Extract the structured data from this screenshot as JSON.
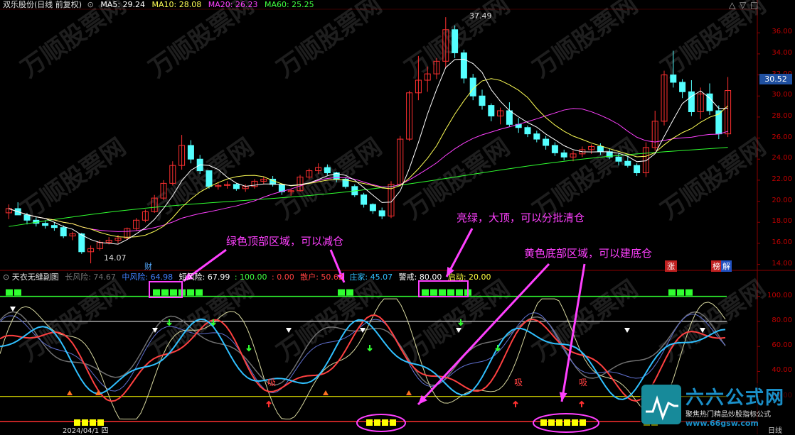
{
  "app": {
    "stock_name": "双乐股份(日线 前复权)",
    "window_icons": [
      "△",
      "▽",
      "□"
    ]
  },
  "ma_legend": [
    {
      "label": "MA5: 29.24",
      "color": "#ffffff"
    },
    {
      "label": "MA10: 28.08",
      "color": "#ffff55"
    },
    {
      "label": "MA20: 26.23",
      "color": "#ff40ff"
    },
    {
      "label": "MA60: 25.25",
      "color": "#40ff40"
    }
  ],
  "price_axis": {
    "ticks": [
      "36.00",
      "34.00",
      "32.00",
      "30.00",
      "28.00",
      "26.00",
      "24.00",
      "22.00",
      "20.00",
      "18.00",
      "16.00",
      "14.00"
    ],
    "current_price": "30.52",
    "high_mark": "37.49",
    "low_mark": "14.07"
  },
  "price_tags": {
    "cai": "财",
    "zhang": "涨",
    "bang": "榜",
    "jie": "解"
  },
  "sub_panel": {
    "title": "天衣无缝副图",
    "indicators": [
      {
        "label": "长风险: 74.67",
        "color": "#707070"
      },
      {
        "label": "中风险: 64.98",
        "color": "#4080ff"
      },
      {
        "label": "短风险: 67.99",
        "color": "#ffffff"
      },
      {
        "label": ": 100.00",
        "color": "#40ff40"
      },
      {
        "label": ": 0.00",
        "color": "#ff4040"
      },
      {
        "label": "散户: 50.62",
        "color": "#ff4040"
      },
      {
        "label": "庄家: 45.07",
        "color": "#30c0ff"
      },
      {
        "label": "警戒: 80.00",
        "color": "#ffffff"
      },
      {
        "label": "启动: 20.00",
        "color": "#ffff40"
      }
    ],
    "ticks": [
      "100.00",
      "80.00",
      "60.00",
      "40.00",
      "20.00"
    ],
    "xi_label": "吸",
    "date_fragment": "2024/04/1 四"
  },
  "annotations": {
    "green_top": "绿色顶部区域，可以减仓",
    "bright_green": "亮绿，大顶，可以分批清仓",
    "yellow_bottom": "黄色底部区域，可以建底仓"
  },
  "brand": {
    "name": "六六公式网",
    "slogan": "聚焦热门精品炒股指标公式",
    "url": "www.66gsw.com",
    "footer_right": "日线"
  },
  "watermark_text": "万顺股票网",
  "colors": {
    "up": "#ff3030",
    "down": "#54ffff",
    "magenta": "#ff40ff",
    "green": "#30ff30",
    "yellow": "#ffff00"
  },
  "chart_data": {
    "type": "candlestick",
    "ylim": [
      13.5,
      37.5
    ],
    "candles": [
      [
        18.9,
        19.7,
        18.3,
        19.3
      ],
      [
        19.3,
        19.9,
        18.7,
        18.7
      ],
      [
        18.7,
        18.9,
        17.8,
        18.2
      ],
      [
        18.2,
        18.5,
        17.6,
        17.9
      ],
      [
        17.9,
        18.2,
        17.4,
        17.7
      ],
      [
        17.7,
        18.0,
        17.2,
        17.5
      ],
      [
        17.5,
        17.7,
        16.5,
        16.7
      ],
      [
        16.7,
        17.1,
        16.3,
        16.9
      ],
      [
        16.9,
        17.0,
        15.0,
        15.2
      ],
      [
        15.2,
        15.8,
        14.1,
        15.5
      ],
      [
        15.5,
        16.3,
        15.3,
        16.1
      ],
      [
        16.1,
        16.6,
        15.9,
        16.3
      ],
      [
        16.3,
        16.8,
        16.0,
        16.5
      ],
      [
        16.5,
        17.5,
        16.4,
        17.4
      ],
      [
        17.4,
        18.4,
        17.2,
        18.2
      ],
      [
        18.2,
        19.2,
        18.0,
        19.0
      ],
      [
        19.0,
        20.6,
        18.9,
        20.3
      ],
      [
        20.3,
        22.0,
        20.1,
        21.7
      ],
      [
        21.7,
        23.8,
        21.5,
        23.4
      ],
      [
        23.4,
        26.3,
        23.0,
        25.3
      ],
      [
        25.3,
        25.8,
        23.6,
        24.0
      ],
      [
        24.0,
        24.4,
        22.6,
        22.9
      ],
      [
        22.9,
        22.7,
        21.2,
        21.4
      ],
      [
        21.4,
        21.8,
        21.1,
        21.5
      ],
      [
        21.5,
        21.9,
        21.2,
        21.6
      ],
      [
        21.6,
        21.7,
        21.0,
        21.2
      ],
      [
        21.2,
        21.6,
        20.9,
        21.4
      ],
      [
        21.4,
        22.1,
        21.2,
        21.9
      ],
      [
        21.9,
        22.3,
        21.6,
        22.1
      ],
      [
        22.1,
        22.4,
        21.4,
        21.6
      ],
      [
        21.6,
        21.7,
        20.6,
        20.9
      ],
      [
        20.9,
        21.2,
        20.5,
        21.0
      ],
      [
        21.0,
        22.5,
        20.9,
        22.3
      ],
      [
        22.3,
        23.1,
        22.1,
        22.9
      ],
      [
        22.9,
        23.6,
        22.6,
        23.2
      ],
      [
        23.2,
        23.5,
        22.5,
        22.7
      ],
      [
        22.7,
        22.8,
        21.8,
        22.1
      ],
      [
        22.1,
        22.2,
        21.2,
        21.4
      ],
      [
        21.4,
        21.6,
        20.4,
        20.6
      ],
      [
        20.6,
        20.8,
        19.4,
        19.7
      ],
      [
        19.7,
        19.8,
        18.8,
        19.1
      ],
      [
        19.1,
        19.4,
        18.3,
        18.6
      ],
      [
        18.6,
        21.9,
        18.4,
        21.6
      ],
      [
        21.6,
        26.2,
        21.4,
        25.9
      ],
      [
        25.9,
        30.5,
        25.7,
        30.3
      ],
      [
        30.3,
        33.8,
        29.6,
        31.5
      ],
      [
        31.5,
        32.8,
        30.4,
        32.1
      ],
      [
        32.1,
        33.6,
        31.6,
        33.3
      ],
      [
        33.3,
        37.49,
        32.7,
        36.3
      ],
      [
        36.3,
        36.7,
        33.6,
        34.1
      ],
      [
        34.1,
        34.4,
        31.2,
        31.7
      ],
      [
        31.7,
        32.1,
        29.6,
        30.0
      ],
      [
        30.0,
        30.6,
        28.7,
        29.1
      ],
      [
        29.1,
        29.3,
        27.6,
        28.1
      ],
      [
        28.1,
        28.9,
        27.3,
        28.6
      ],
      [
        28.6,
        29.4,
        27.1,
        27.3
      ],
      [
        27.3,
        27.9,
        26.5,
        27.0
      ],
      [
        27.0,
        27.2,
        26.1,
        26.4
      ],
      [
        26.4,
        26.7,
        25.6,
        25.9
      ],
      [
        25.9,
        26.2,
        24.9,
        25.3
      ],
      [
        25.3,
        25.6,
        24.3,
        24.6
      ],
      [
        24.6,
        24.9,
        23.9,
        24.2
      ],
      [
        24.2,
        24.8,
        23.8,
        24.5
      ],
      [
        24.5,
        25.2,
        24.2,
        24.9
      ],
      [
        24.9,
        25.4,
        24.5,
        25.2
      ],
      [
        25.2,
        25.5,
        24.4,
        24.7
      ],
      [
        24.7,
        25.0,
        24.0,
        24.2
      ],
      [
        24.2,
        24.6,
        23.4,
        23.8
      ],
      [
        23.8,
        24.2,
        23.2,
        23.4
      ],
      [
        23.4,
        23.6,
        22.4,
        22.7
      ],
      [
        22.7,
        25.6,
        22.3,
        25.1
      ],
      [
        25.1,
        28.6,
        24.8,
        27.6
      ],
      [
        27.6,
        32.4,
        27.2,
        32.0
      ],
      [
        32.0,
        34.3,
        30.8,
        31.3
      ],
      [
        31.3,
        31.6,
        29.8,
        30.4
      ],
      [
        30.4,
        31.5,
        28.1,
        28.5
      ],
      [
        28.5,
        30.8,
        27.8,
        30.2
      ],
      [
        30.2,
        31.2,
        28.2,
        28.6
      ],
      [
        28.6,
        29.1,
        25.9,
        26.4
      ],
      [
        26.4,
        31.8,
        26.1,
        30.52
      ]
    ],
    "ma5_last": 29.24,
    "ma10_last": 28.08,
    "ma20_last": 26.23,
    "ma60_last": 25.25
  }
}
